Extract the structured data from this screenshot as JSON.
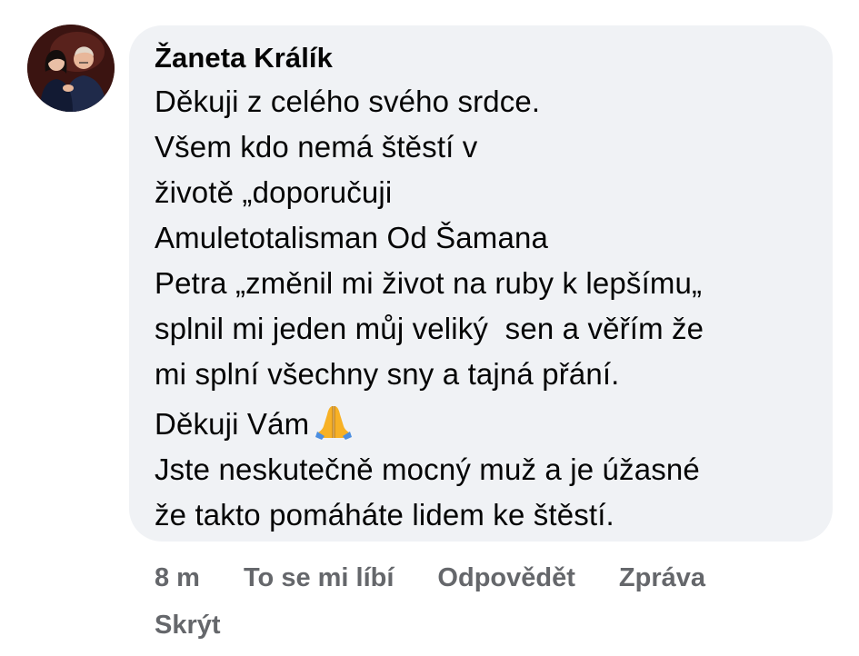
{
  "comment": {
    "author": "Žaneta Králík",
    "lines": [
      "Děkuji z celého svého srdce.",
      "Všem kdo nemá štěstí v",
      "životě „doporučuji",
      "Amuletotalisman Od Šamana",
      "Petra „změnil mi život na ruby k lepšímu„",
      "splnil mi jeden můj veliký  sen a věřím že",
      "mi splní všechny sny a tajná přání."
    ],
    "thanks": "Děkuji Vám",
    "thanks_emoji": "praying-hands-icon",
    "lines2": [
      "Jste neskutečně mocný muž a je úžasné",
      "že takto pomáháte lidem ke štěstí."
    ]
  },
  "actions": {
    "time": "8 m",
    "like": "To se mi líbí",
    "reply": "Odpovědět",
    "message": "Zpráva",
    "hide": "Skrýt"
  },
  "colors": {
    "bubble": "#f0f2f5",
    "text": "#050505",
    "muted": "#65676b",
    "emoji": "#f7b125"
  }
}
